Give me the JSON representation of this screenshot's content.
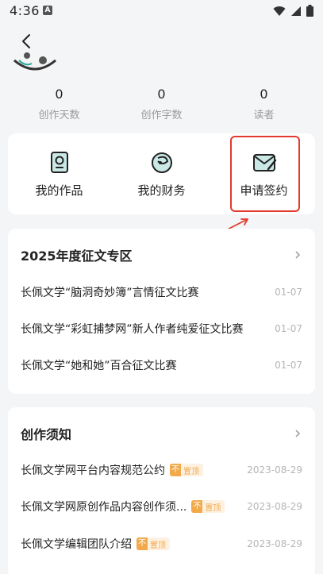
{
  "status_bar": {
    "time": "4:36",
    "notification_glyph": "A"
  },
  "stats": [
    {
      "value": "0",
      "label": "创作天数"
    },
    {
      "value": "0",
      "label": "创作字数"
    },
    {
      "value": "0",
      "label": "读者"
    }
  ],
  "actions": [
    {
      "label": "我的作品",
      "icon": "works-icon"
    },
    {
      "label": "我的财务",
      "icon": "finance-icon"
    },
    {
      "label": "申请签约",
      "icon": "contract-icon"
    }
  ],
  "contest": {
    "title": "2025年度征文专区",
    "items": [
      {
        "title": "长佩文学“脑洞奇妙簿”言情征文比赛",
        "date": "01-07"
      },
      {
        "title": "长佩文学“彩虹捕梦网”新人作者纯爱征文比赛",
        "date": "01-07"
      },
      {
        "title": "长佩文学“她和她”百合征文比赛",
        "date": "01-07"
      }
    ]
  },
  "notice": {
    "title": "创作须知",
    "pin_mark": "不",
    "pin_text": "置顶",
    "items": [
      {
        "title": "长佩文学网平台内容规范公约",
        "date": "2023-08-29",
        "pinned": true
      },
      {
        "title": "长佩文学网原创作品内容创作须...",
        "date": "2023-08-29",
        "pinned": true
      },
      {
        "title": "长佩文学编辑团队介绍",
        "date": "2023-08-29",
        "pinned": true
      }
    ]
  },
  "colors": {
    "accent_red": "#e23a2e",
    "pin_orange": "#f2a94a",
    "icon_teal": "#2aa79b"
  }
}
